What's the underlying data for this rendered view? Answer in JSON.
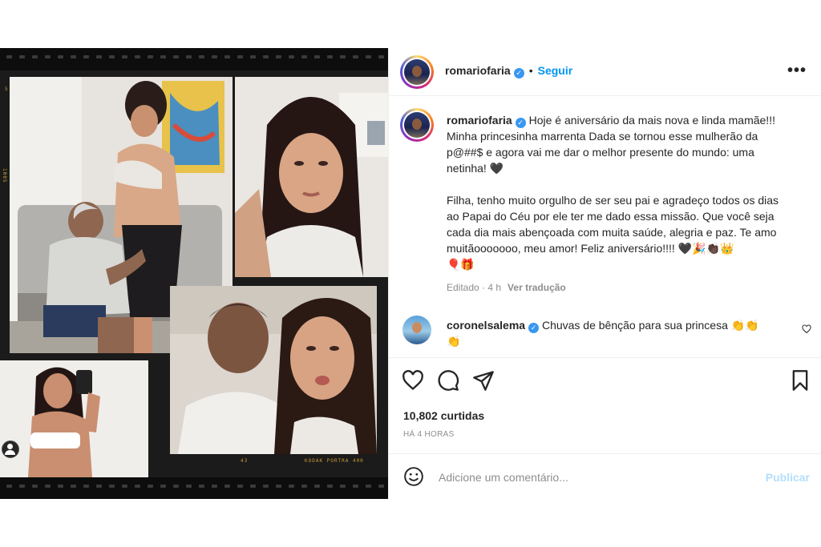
{
  "post": {
    "author": "romariofaria",
    "follow_label": "Seguir",
    "more_label": "•••",
    "caption": "Hoje é aniversário da mais nova e linda mamãe!!! Minha princesinha marrenta Dada se tornou esse mulherão da p@##$ e agora vai me dar o melhor presente do mundo: uma netinha! 🖤\n\nFilha, tenho muito orgulho de ser seu pai e agradeço todos os dias ao Papai do Céu por ele ter me dado essa missão. Que você seja cada dia mais abençoada com muita saúde, alegria e paz. Te amo muitãooooooo, meu amor! Feliz aniversário!!!! 🖤🎉👏🏿👑\n🎈🎁",
    "edited_label": "Editado · 4 h",
    "translate_label": "Ver tradução"
  },
  "comments": [
    {
      "author": "coronelsalema",
      "text": "Chuvas de bênção para sua princesa 👏👏\n👏"
    }
  ],
  "stats": {
    "likes": "10,802 curtidas",
    "time": "HÁ 4 HORAS"
  },
  "composer": {
    "placeholder": "Adicione um comentário...",
    "publish_label": "Publicar"
  },
  "film_marks": {
    "top_left": "5",
    "side_left": "1005",
    "bottom_right": "KODAK PORTRA 400",
    "number": "43"
  }
}
